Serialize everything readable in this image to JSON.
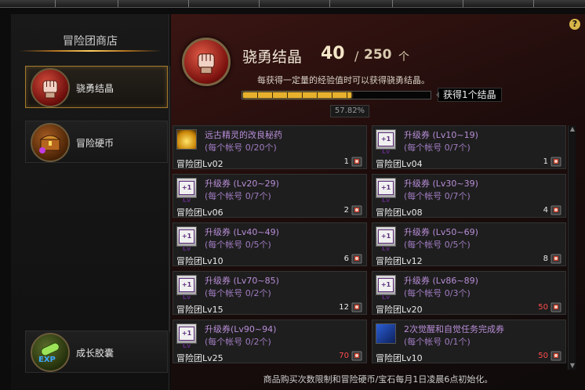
{
  "sidebar": {
    "title": "冒险团商店",
    "items": [
      {
        "label": "骁勇结晶",
        "active": true
      },
      {
        "label": "冒险硬币",
        "active": false
      },
      {
        "label": "成长胶囊",
        "active": false
      }
    ]
  },
  "hero": {
    "name": "骁勇结晶",
    "current": "40",
    "slash": "/",
    "max": "250",
    "unit": "个",
    "description": "每获得一定量的经验值时可以获得骁勇结晶。",
    "progress": 0.5782,
    "progress_text": "57.82%",
    "reward_text": "获得1个结晶"
  },
  "help": "?",
  "items": [
    {
      "name": "远古精灵的改良秘药",
      "limit": "(每个帐号 0/20个)",
      "req": "冒险团Lv02",
      "price": "1",
      "price_red": false,
      "icon": "potion-icon"
    },
    {
      "name": "升级券 (Lv10~19)",
      "limit": "(每个帐号 0/7个)",
      "req": "冒险团Lv04",
      "price": "1",
      "price_red": false,
      "icon": "level-ticket-icon"
    },
    {
      "name": "升级券 (Lv20~29)",
      "limit": "(每个帐号 0/7个)",
      "req": "冒险团Lv06",
      "price": "2",
      "price_red": false,
      "icon": "level-ticket-icon"
    },
    {
      "name": "升级券 (Lv30~39)",
      "limit": "(每个帐号 0/7个)",
      "req": "冒险团Lv08",
      "price": "4",
      "price_red": false,
      "icon": "level-ticket-icon"
    },
    {
      "name": "升级券 (Lv40~49)",
      "limit": "(每个帐号 0/5个)",
      "req": "冒险团Lv10",
      "price": "6",
      "price_red": false,
      "icon": "level-ticket-icon"
    },
    {
      "name": "升级券 (Lv50~69)",
      "limit": "(每个帐号 0/5个)",
      "req": "冒险团Lv12",
      "price": "8",
      "price_red": false,
      "icon": "level-ticket-icon"
    },
    {
      "name": "升级券 (Lv70~85)",
      "limit": "(每个帐号 0/2个)",
      "req": "冒险团Lv15",
      "price": "12",
      "price_red": false,
      "icon": "level-ticket-icon"
    },
    {
      "name": "升级券 (Lv86~89)",
      "limit": "(每个帐号 0/3个)",
      "req": "冒险团Lv20",
      "price": "50",
      "price_red": true,
      "icon": "level-ticket-icon"
    },
    {
      "name": "升级券(Lv90~94)",
      "limit": "(每个帐号 0/2个)",
      "req": "冒险团Lv25",
      "price": "70",
      "price_red": true,
      "icon": "level-ticket-icon"
    },
    {
      "name": "2次觉醒和自觉任务完成券",
      "limit": "(每个帐号 0/1个)",
      "req": "冒险团Lv10",
      "price": "50",
      "price_red": true,
      "icon": "awakening-ticket-icon"
    }
  ],
  "footer": "商品购买次数限制和冒险硬币/宝石每月1日凌晨6点初始化。",
  "ticket_glyph": "+1 Lv"
}
